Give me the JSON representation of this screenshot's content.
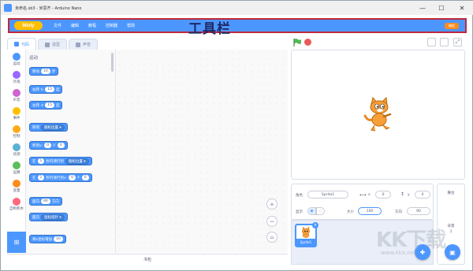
{
  "window": {
    "title": "未命名.sb3 - 米思齐 - Arduino Nano",
    "minimize": "—",
    "maximize": "☐",
    "close": "✕"
  },
  "menubar": {
    "logo": "Mixly",
    "items": [
      "文件",
      "编辑",
      "教程",
      "控制器",
      "帮助"
    ],
    "annotation": "工具栏",
    "mode_toggle": "编程"
  },
  "tabs": [
    {
      "label": "代码",
      "active": true,
      "icon": "code-icon"
    },
    {
      "label": "造型",
      "active": false,
      "icon": "brush-icon"
    },
    {
      "label": "声音",
      "active": false,
      "icon": "speaker-icon"
    }
  ],
  "categories": [
    {
      "label": "运动",
      "color": "#4c97ff"
    },
    {
      "label": "外观",
      "color": "#9966ff"
    },
    {
      "label": "声音",
      "color": "#cf63cf"
    },
    {
      "label": "事件",
      "color": "#ffbf00"
    },
    {
      "label": "控制",
      "color": "#ffab19"
    },
    {
      "label": "侦测",
      "color": "#5cb1d6"
    },
    {
      "label": "运算",
      "color": "#59c059"
    },
    {
      "label": "变量",
      "color": "#ff8c1a"
    },
    {
      "label": "自制积木",
      "color": "#ff6680"
    }
  ],
  "palette": {
    "heading": "运动",
    "blocks": {
      "move": {
        "a": "移动",
        "v": "10",
        "b": "步"
      },
      "turn_right": {
        "a": "右转 ↻",
        "v": "15",
        "b": "度"
      },
      "turn_left": {
        "a": "左转 ↺",
        "v": "15",
        "b": "度"
      },
      "goto": {
        "a": "移到",
        "d": "随机位置 ▾"
      },
      "goto_xy": {
        "a": "移到x:",
        "v1": "0",
        "m": "y:",
        "v2": "0"
      },
      "glide": {
        "a": "在",
        "v": "1",
        "m": "秒内滑行到",
        "d": "随机位置 ▾"
      },
      "glide_xy": {
        "a": "在",
        "v": "1",
        "m": "秒内滑行到x:",
        "v1": "0",
        "n": "y:",
        "v2": "0"
      },
      "point": {
        "a": "面向",
        "v": "90",
        "b": "方向"
      },
      "point_to": {
        "a": "面向",
        "d": "鼠标指针 ▾"
      },
      "change_x": {
        "a": "将x坐标增加",
        "v": "10"
      }
    }
  },
  "zoom": {
    "in": "+",
    "out": "−",
    "reset": "="
  },
  "backpack": "书包",
  "stage_controls": {
    "flag": "green-flag-icon",
    "stop": "stop-icon"
  },
  "sprite_info": {
    "sprite_label": "角色",
    "sprite_name": "Sprite1",
    "x_label": "x",
    "x_value": "0",
    "y_label": "y",
    "y_value": "0",
    "show_label": "显示",
    "size_label": "大小",
    "size_value": "100",
    "direction_label": "方向",
    "direction_value": "90"
  },
  "sprites": [
    {
      "name": "Sprite1"
    }
  ],
  "stage_panel": {
    "title": "舞台",
    "backdrop_label": "背景",
    "backdrop_count": "1"
  },
  "watermark": {
    "big": "KK下载",
    "url": "www.kkx.net"
  }
}
